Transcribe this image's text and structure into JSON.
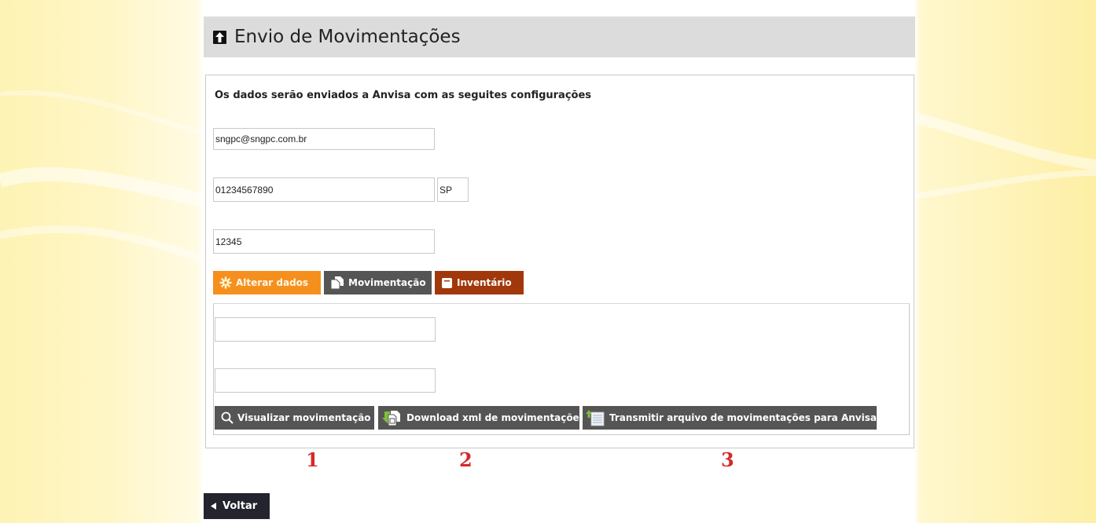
{
  "page": {
    "title": "Envio de Movimentações",
    "intro": "Os dados serão enviados a Anvisa com as seguites configurações"
  },
  "form": {
    "email": "sngpc@sngpc.com.br",
    "cnpj": "01234567890",
    "uf": "SP",
    "code": "12345",
    "period_start": "",
    "period_end": ""
  },
  "buttons": {
    "alterar": "Alterar dados",
    "movimentacao": "Movimentação",
    "inventario": "Inventário",
    "visualizar": "Visualizar movimentação",
    "download": "Download xml de movimentações",
    "transmitir": "Transmitir arquivo de movimentações para Anvisa",
    "voltar": "Voltar"
  },
  "annotations": [
    "1",
    "2",
    "3"
  ],
  "colors": {
    "orange": "#f5901e",
    "dark_gray": "#555555",
    "brown": "#a1380b",
    "navy": "#24242e",
    "annotation_red": "#d52a2a",
    "header_gray": "#dcdcdc"
  },
  "icons": {
    "header": "upload-arrow-icon",
    "alterar": "gear-icon",
    "movimentacao": "documents-icon",
    "inventario": "inventory-icon",
    "visualizar": "search-icon",
    "download": "download-xml-icon",
    "transmitir": "transmit-icon",
    "voltar": "triangle-left-icon"
  }
}
